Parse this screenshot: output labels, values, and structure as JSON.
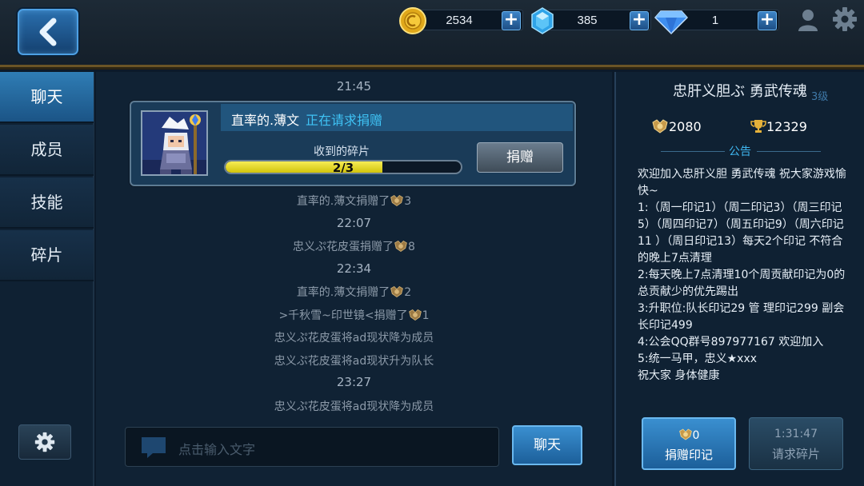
{
  "topbar": {
    "gold": "2534",
    "crystal": "385",
    "diamond": "1"
  },
  "nav": {
    "items": [
      "聊天",
      "成员",
      "技能",
      "碎片"
    ],
    "active_index": 0
  },
  "chat": {
    "top_time": "21:45",
    "request": {
      "name": "直率的.薄文",
      "status": "正在请求捐赠",
      "fragments_label": "收到的碎片",
      "progress_text": "2/3",
      "progress_value": 0.667,
      "donate_label": "捐赠"
    },
    "log": [
      {
        "kind": "msg",
        "text": "直率的.薄文捐赠了",
        "medal": true,
        "count": "3"
      },
      {
        "kind": "time",
        "text": "22:07"
      },
      {
        "kind": "msg",
        "text": "忠义ぷ花皮蛋捐赠了",
        "medal": true,
        "count": "8"
      },
      {
        "kind": "time",
        "text": "22:34"
      },
      {
        "kind": "msg",
        "text": "直率的.薄文捐赠了",
        "medal": true,
        "count": "2"
      },
      {
        "kind": "msg",
        "text": ">千秋雪~印世镜<捐赠了",
        "medal": true,
        "count": "1"
      },
      {
        "kind": "msg",
        "text": "忠义ぷ花皮蛋将ad现状降为成员",
        "medal": false,
        "count": ""
      },
      {
        "kind": "msg",
        "text": "忠义ぷ花皮蛋将ad现状升为队长",
        "medal": false,
        "count": ""
      },
      {
        "kind": "time",
        "text": "23:27"
      },
      {
        "kind": "msg",
        "text": "忠义ぷ花皮蛋将ad现状降为成员",
        "medal": false,
        "count": ""
      }
    ],
    "input_placeholder": "点击输入文字",
    "send_label": "聊天"
  },
  "guild": {
    "name": "忠肝义胆ぶ 勇武传魂",
    "level": "3级",
    "medals": "2080",
    "trophies": "12329",
    "notice_title": "公告",
    "notice_text": "欢迎加入忠肝义胆 勇武传魂 祝大家游戏愉快~\n1:（周一印记1）（周二印记3）（周三印记5）（周四印记7）（周五印记9）（周六印记11 ）（周日印记13）每天2个印记 不符合的晚上7点清理\n2:每天晚上7点清理10个周贡献印记为0的 总贡献少的优先踢出\n3:升职位:队长印记29 管 理印记299 副会长印记499\n4:公会QQ群号897977167 欢迎加入\n5:统一马甲，忠义★xxx\n祝大家 身体健康",
    "donate_mark": {
      "count": "0",
      "label": "捐赠印记"
    },
    "request_frag": {
      "timer": "1:31:47",
      "label": "请求碎片"
    }
  },
  "colors": {
    "accent_blue": "#3a8fd0",
    "status_cyan": "#3fc3f5",
    "progress_yellow": "#f6ec55",
    "gold_border": "#6a5526"
  }
}
